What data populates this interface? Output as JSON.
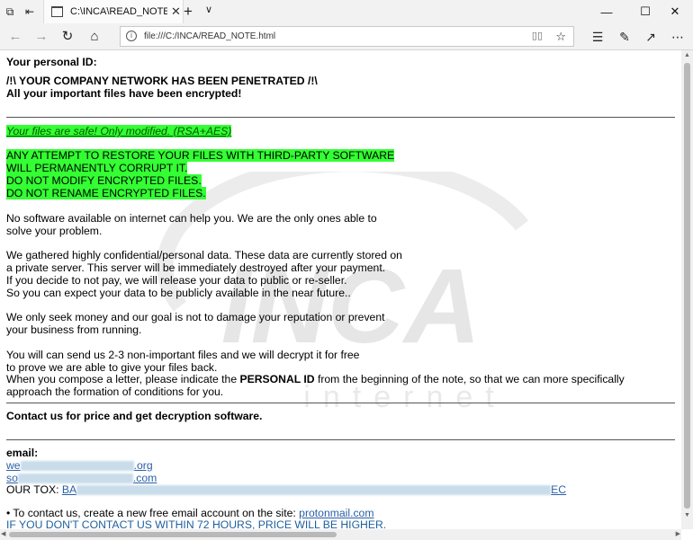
{
  "browser": {
    "tab_title": "C:\\INCA\\READ_NOTE.ht",
    "tab_close": "✕",
    "new_tab": "+",
    "tab_menu": "∨",
    "url": "file:///C:/INCA/READ_NOTE.html",
    "minimize": "—",
    "maximize": "☐",
    "close": "✕"
  },
  "note": {
    "personal_id_label": "Your personal ID:",
    "headline1": "/!\\ YOUR COMPANY NETWORK HAS BEEN PENETRATED /!\\",
    "headline2": "All your important files have been encrypted!",
    "safe_line": "Your files are safe! Only modified. (RSA+AES)",
    "warn1": "ANY ATTEMPT TO RESTORE YOUR FILES WITH THIRD-PARTY SOFTWARE",
    "warn2": "WILL PERMANENTLY CORRUPT IT.",
    "warn3": "DO NOT MODIFY ENCRYPTED FILES.",
    "warn4": "DO NOT RENAME ENCRYPTED FILES.",
    "p1a": "No software available on internet can help you. We are the only ones able to",
    "p1b": "solve your problem.",
    "p2a": "We gathered highly confidential/personal data. These data are currently stored on",
    "p2b": "a private server. This server will be immediately destroyed after your payment.",
    "p2c": "If you decide to not pay, we will release your data to public or re-seller.",
    "p2d": "So you can expect your data to be publicly available in the near future..",
    "p3a": "We only seek money and our goal is not to damage your reputation or prevent",
    "p3b": "your business from running.",
    "p4a": "You will can send us 2-3 non-important files and we will decrypt it for free",
    "p4b": "to prove we are able to give your files back.",
    "p4c_pre": "When you compose a letter, please indicate the ",
    "p4c_bold": "PERSONAL ID",
    "p4c_post": " from the beginning of the note, so that we can more specifically",
    "p4d": "approach the formation of conditions for you.",
    "contact": "Contact us for price and get decryption software.",
    "email_label": "email:",
    "email1_start": "we",
    "email1_end": ".org",
    "email2_start": "so",
    "email2_end": ".com",
    "tox_label": "OUR TOX: ",
    "tox_start": "BA",
    "tox_end": "EC",
    "bullet_pre": "• To contact us, create a new free email account on the site: ",
    "bullet_link": "protonmail.com",
    "deadline": "IF YOU DON'T CONTACT US WITHIN 72 HOURS, PRICE WILL BE HIGHER."
  },
  "watermark": {
    "brand": "INCA",
    "sub": "internet",
    "color": "#e6e6e6"
  },
  "colors": {
    "highlight": "#33ff33",
    "link": "#2b5fa6"
  }
}
